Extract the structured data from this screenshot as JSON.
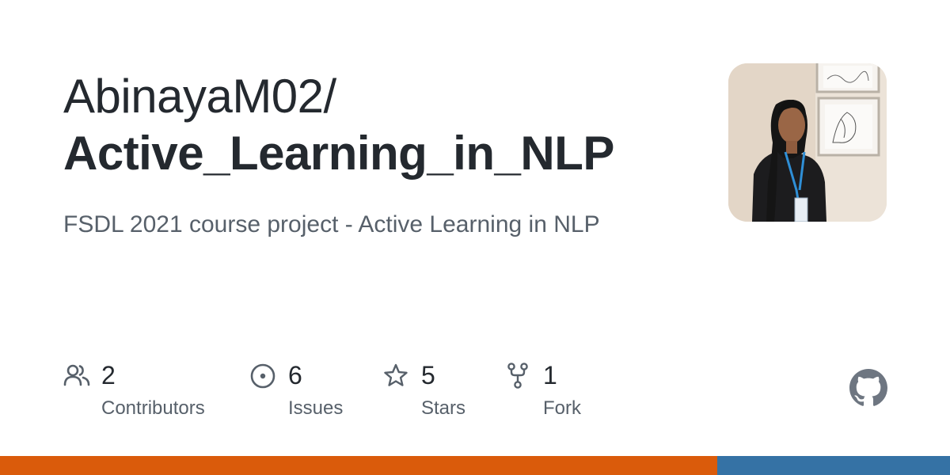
{
  "repo": {
    "owner": "AbinayaM02/",
    "name": "Active_Learning_in_NLP",
    "description": "FSDL 2021 course project - Active Learning in NLP"
  },
  "stats": [
    {
      "count": "2",
      "label": "Contributors",
      "icon": "people-icon"
    },
    {
      "count": "6",
      "label": "Issues",
      "icon": "issue-opened-icon"
    },
    {
      "count": "5",
      "label": "Stars",
      "icon": "star-icon"
    },
    {
      "count": "1",
      "label": "Fork",
      "icon": "repo-forked-icon"
    }
  ],
  "languages": [
    {
      "color": "#da5b0b",
      "fraction": 0.755
    },
    {
      "color": "#3572a5",
      "fraction": 0.245
    }
  ],
  "colors": {
    "icon": "#57606a",
    "github_logo": "#6e7681"
  }
}
